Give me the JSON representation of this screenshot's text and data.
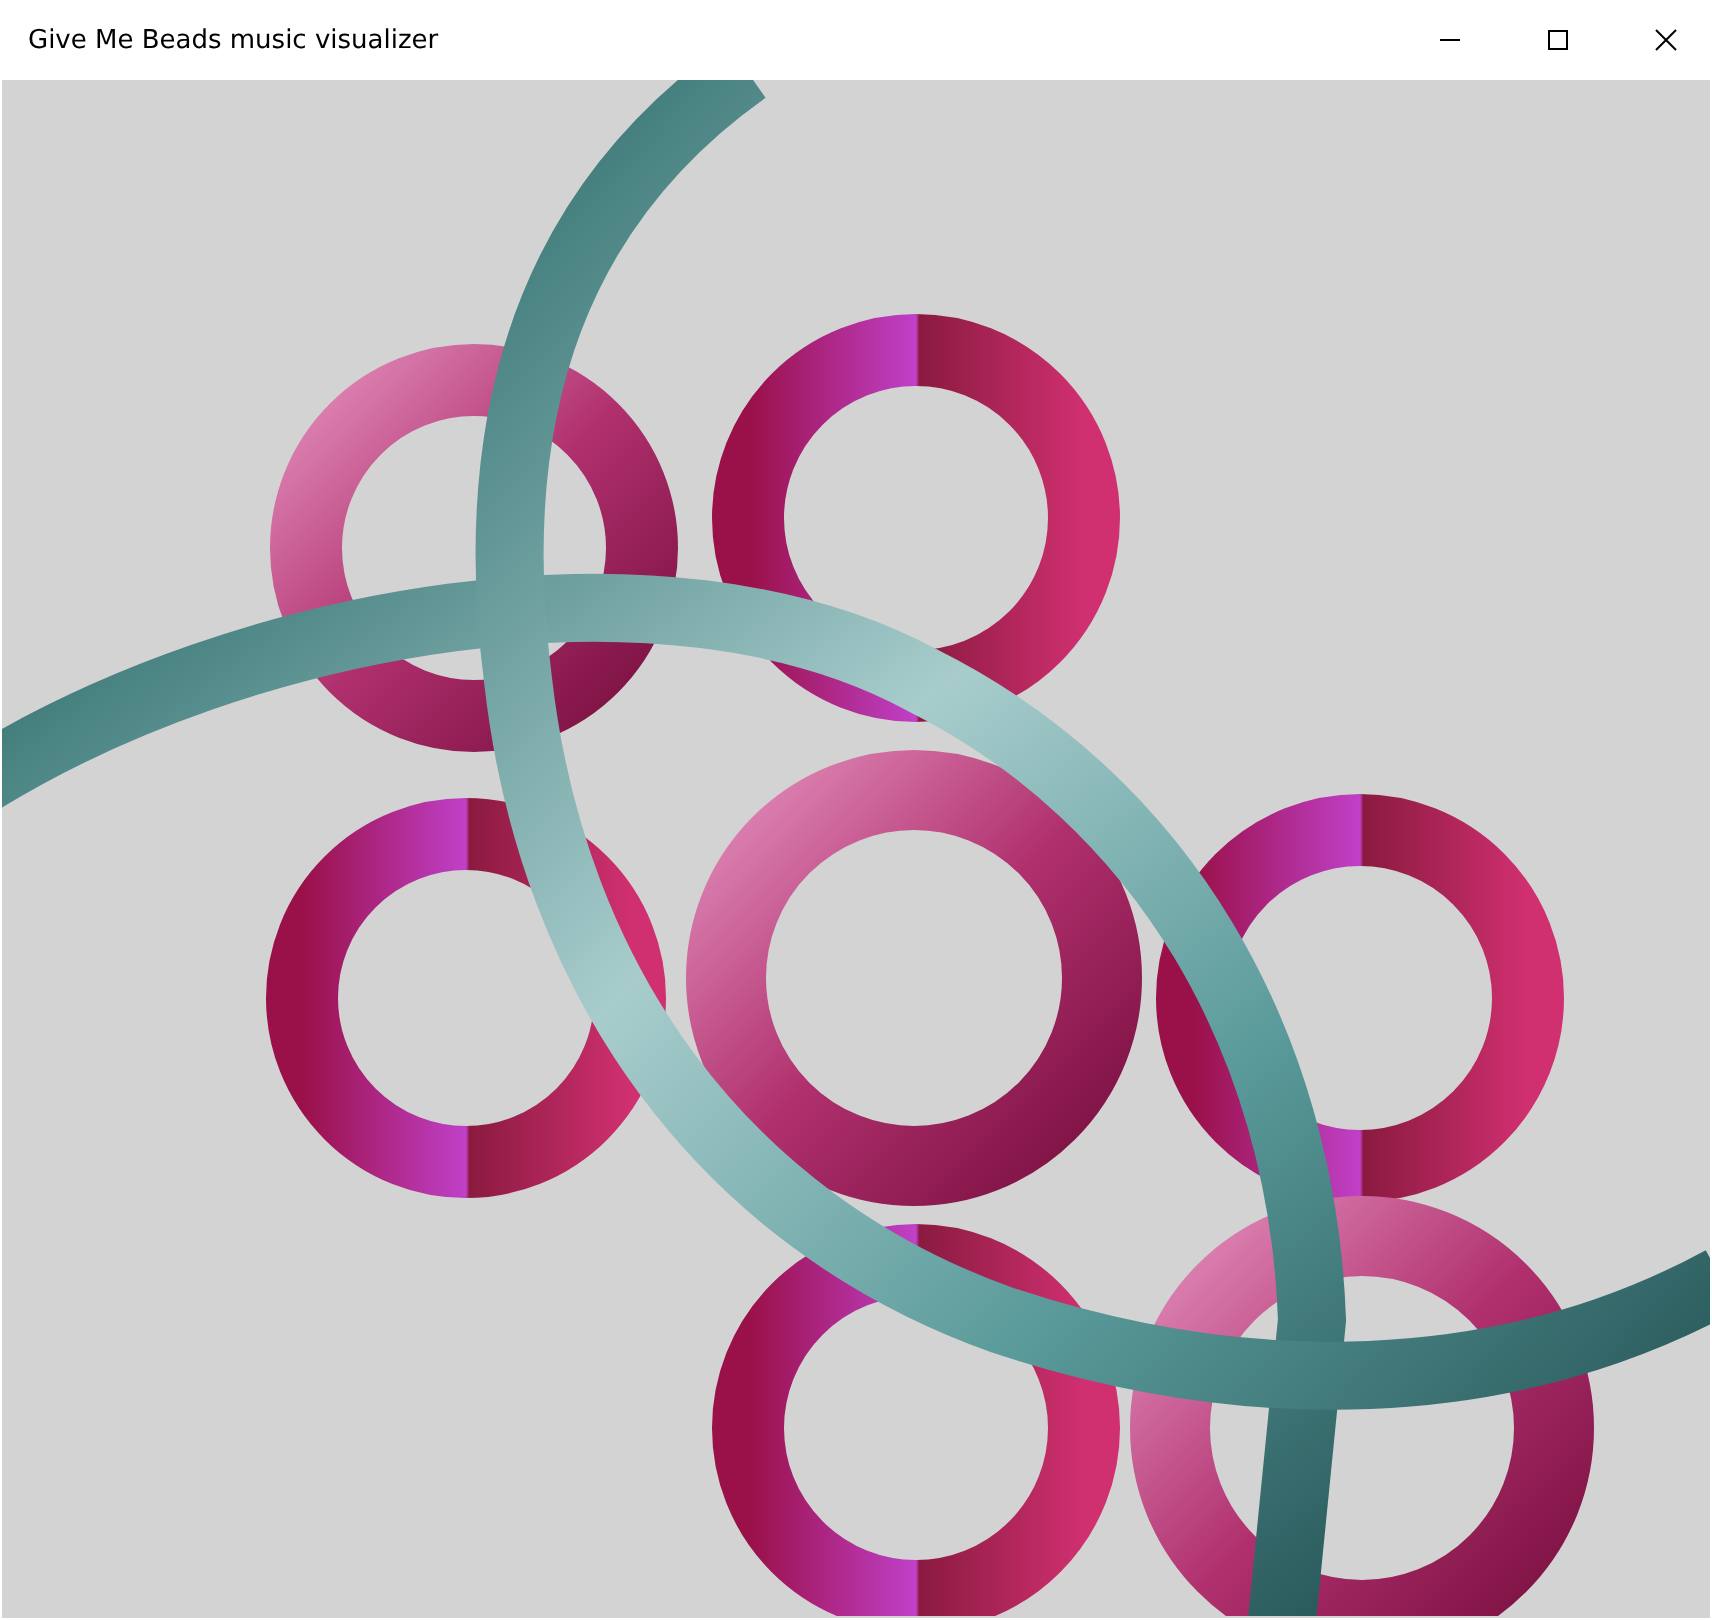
{
  "window": {
    "title": "Give Me Beads music visualizer"
  }
}
